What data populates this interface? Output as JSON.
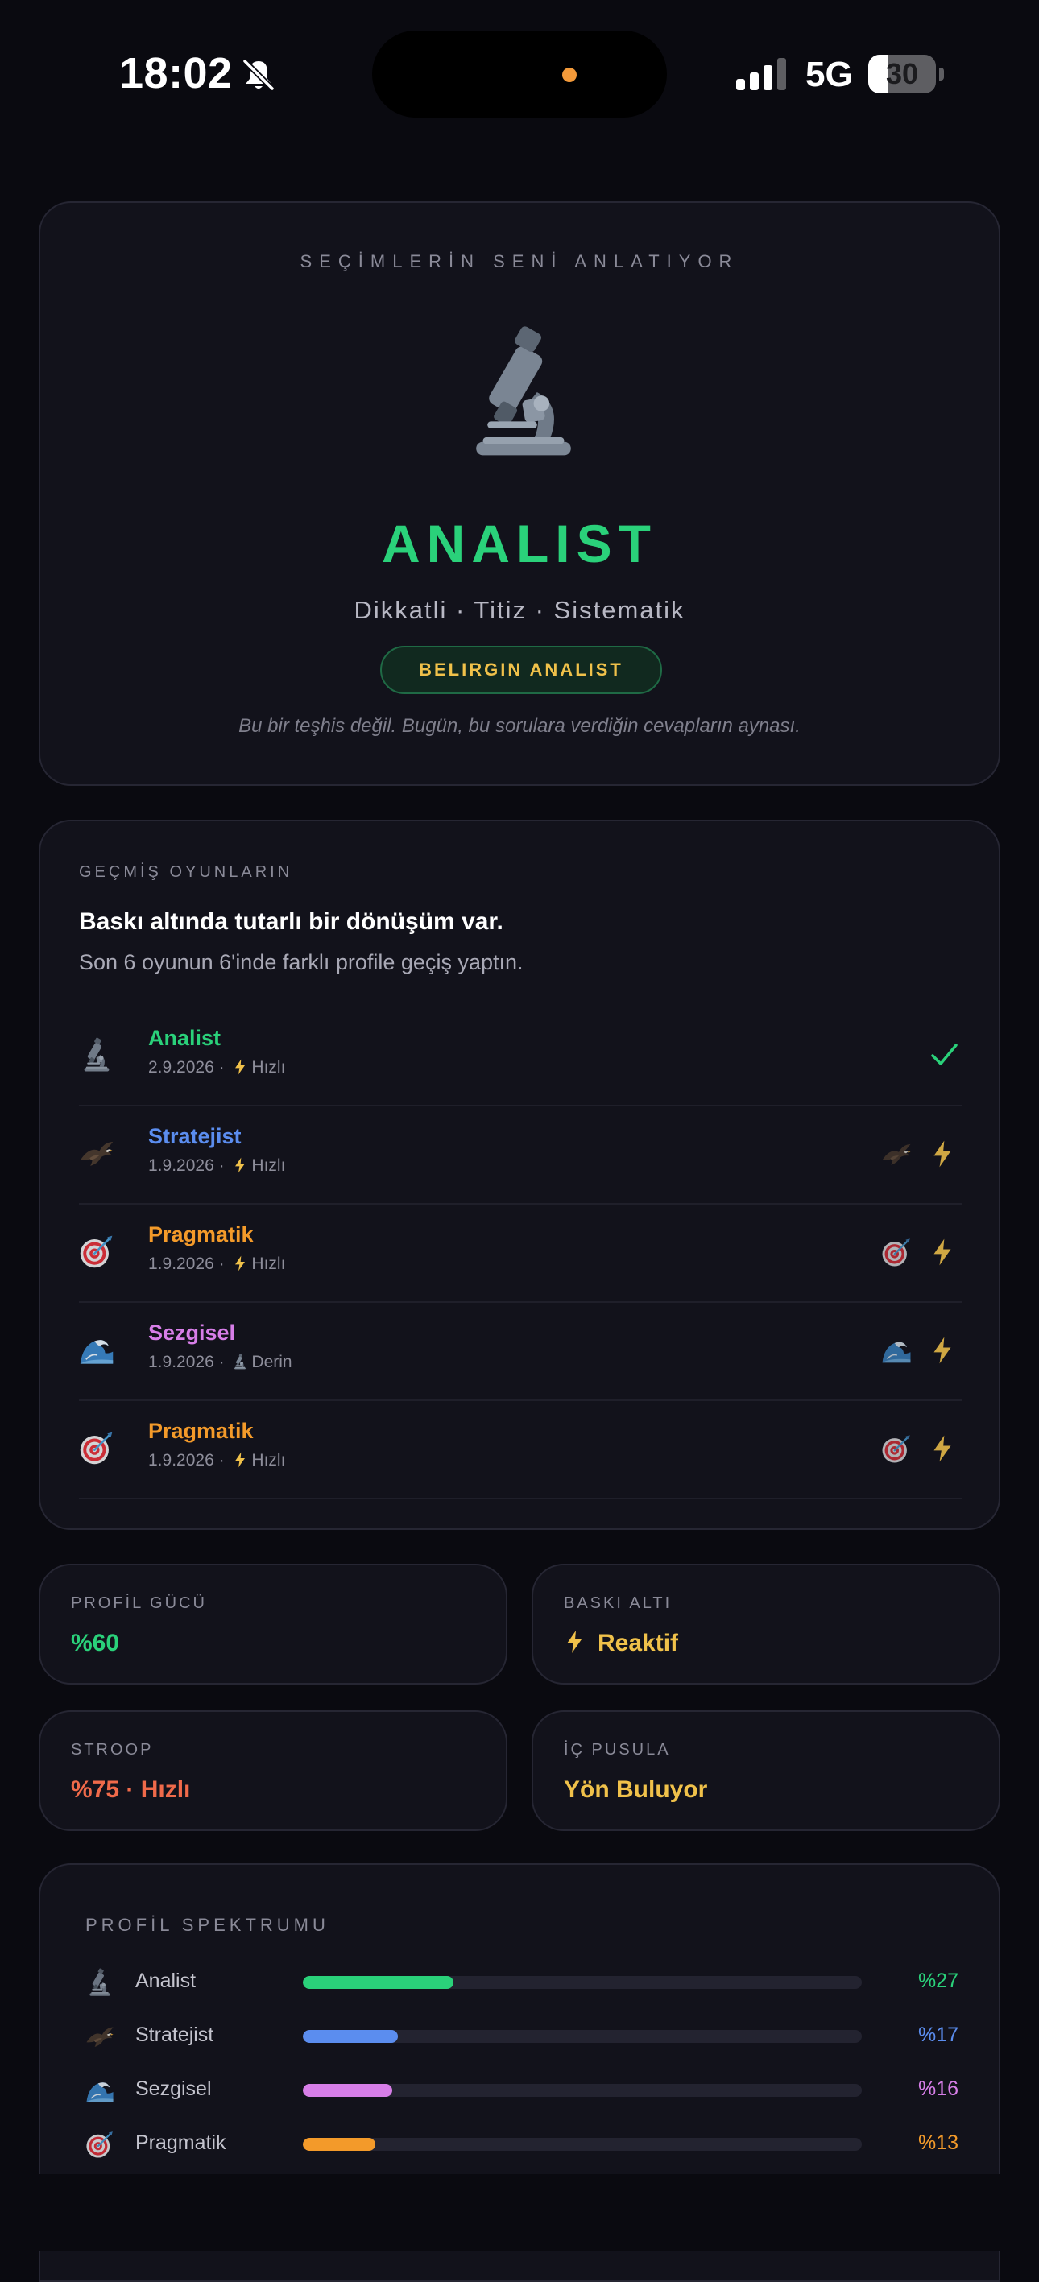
{
  "status_bar": {
    "time": "18:02",
    "network": "5G",
    "battery_level": "30",
    "battery_fraction": 0.3
  },
  "colors": {
    "analist": "#2ad17a",
    "stratejist": "#5b8def",
    "pragmatik": "#f39a2a",
    "sezgisel": "#d77ee8",
    "warning": "#f0c14a",
    "danger": "#f06a4a"
  },
  "hero": {
    "kicker": "SEÇİMLERİN SENİ ANLATIYOR",
    "icon": "microscope-icon",
    "title": "ANALIST",
    "traits": "Dikkatli · Titiz · Sistematik",
    "badge": "BELIRGIN ANALIST",
    "disclaimer": "Bu bir teşhis değil. Bugün, bu sorulara verdiğin cevapların aynası."
  },
  "history": {
    "kicker": "GEÇMİŞ OYUNLARIN",
    "headline": "Baskı altında tutarlı bir dönüşüm var.",
    "subtext": "Son 6 oyunun 6'inde farklı profile geçiş yaptın.",
    "rows": [
      {
        "name": "Analist",
        "date": "2.9.2026",
        "mode": "Hızlı",
        "mode_icon": "bolt-icon",
        "icon": "microscope-icon",
        "color": "#2ad17a",
        "current": true
      },
      {
        "name": "Stratejist",
        "date": "1.9.2026",
        "mode": "Hızlı",
        "mode_icon": "bolt-icon",
        "icon": "eagle-icon",
        "color": "#5b8def",
        "current": false
      },
      {
        "name": "Pragmatik",
        "date": "1.9.2026",
        "mode": "Hızlı",
        "mode_icon": "bolt-icon",
        "icon": "target-icon",
        "color": "#f39a2a",
        "current": false
      },
      {
        "name": "Sezgisel",
        "date": "1.9.2026",
        "mode": "Derin",
        "mode_icon": "microscope-icon",
        "icon": "wave-icon",
        "color": "#d77ee8",
        "current": false
      },
      {
        "name": "Pragmatik",
        "date": "1.9.2026",
        "mode": "Hızlı",
        "mode_icon": "bolt-icon",
        "icon": "target-icon",
        "color": "#f39a2a",
        "current": false
      }
    ]
  },
  "stats": {
    "profile_strength": {
      "label": "PROFİL GÜCÜ",
      "value": "%60",
      "color": "#2ad17a"
    },
    "under_pressure": {
      "label": "BASKI ALTI",
      "value": "Reaktif",
      "icon": "bolt-icon",
      "color": "#f0c14a"
    },
    "stroop": {
      "label": "STROOP",
      "value": "%75 · Hızlı",
      "color": "#f06a4a"
    },
    "inner_compass": {
      "label": "İÇ PUSULA",
      "value": "Yön Buluyor",
      "color": "#f0c14a"
    }
  },
  "spectrum": {
    "kicker": "PROFİL SPEKTRUMU",
    "items": [
      {
        "name": "Analist",
        "pct_label": "%27",
        "pct": 27,
        "icon": "microscope-icon",
        "color": "#2ad17a"
      },
      {
        "name": "Stratejist",
        "pct_label": "%17",
        "pct": 17,
        "icon": "eagle-icon",
        "color": "#5b8def"
      },
      {
        "name": "Sezgisel",
        "pct_label": "%16",
        "pct": 16,
        "icon": "wave-icon",
        "color": "#d77ee8"
      },
      {
        "name": "Pragmatik",
        "pct_label": "%13",
        "pct": 13,
        "icon": "target-icon",
        "color": "#f39a2a"
      }
    ]
  }
}
